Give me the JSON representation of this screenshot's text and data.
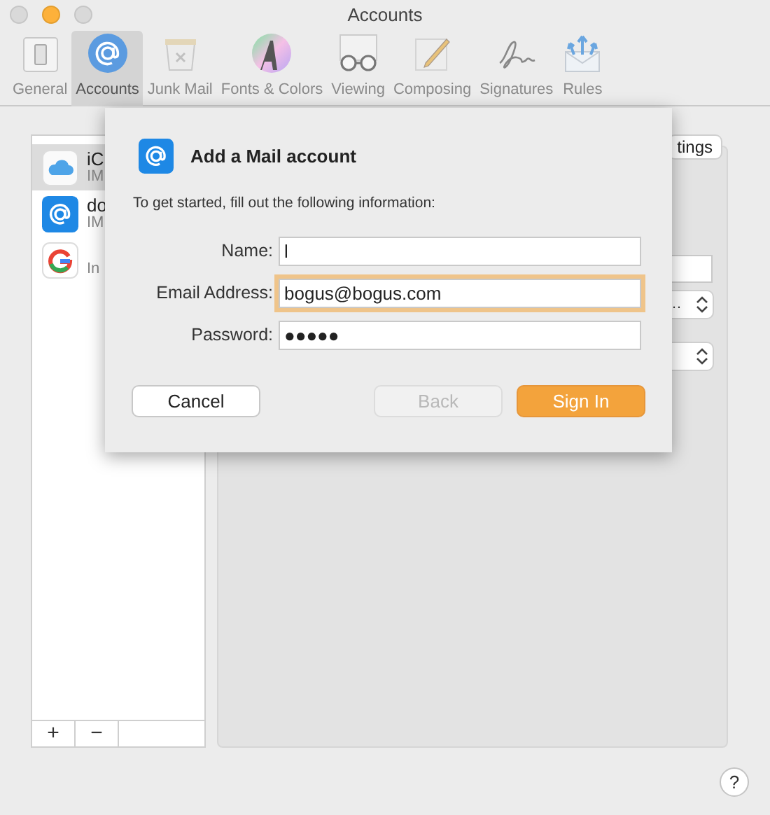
{
  "window": {
    "title": "Accounts"
  },
  "toolbar": [
    {
      "label": "General",
      "selected": false
    },
    {
      "label": "Accounts",
      "selected": true
    },
    {
      "label": "Junk Mail",
      "selected": false
    },
    {
      "label": "Fonts & Colors",
      "selected": false
    },
    {
      "label": "Viewing",
      "selected": false
    },
    {
      "label": "Composing",
      "selected": false
    },
    {
      "label": "Signatures",
      "selected": false
    },
    {
      "label": "Rules",
      "selected": false
    }
  ],
  "accounts": [
    {
      "name": "iC",
      "type": "IM",
      "selected": true
    },
    {
      "name": "do",
      "type": "IM",
      "selected": false
    },
    {
      "type": "In",
      "selected": false
    }
  ],
  "list_buttons": [
    "+",
    "−"
  ],
  "settings_button": "tings",
  "right_controls": [
    {
      "kind": "text"
    },
    {
      "kind": "select",
      "value": "…"
    },
    {
      "kind": "select"
    }
  ],
  "dialog": {
    "title": "Add a Mail account",
    "intro": "To get started, fill out the following information:",
    "fields": [
      {
        "label": "Name:",
        "value": "l",
        "focused": false
      },
      {
        "label": "Email Address:",
        "value": "bogus@bogus.com",
        "focused": true
      },
      {
        "label": "Password:",
        "value": "●●●●●",
        "focused": false
      }
    ],
    "buttons": [
      {
        "label": "Cancel",
        "kind": "normal",
        "disabled": false
      },
      {
        "label": "Back",
        "kind": "normal",
        "disabled": true
      },
      {
        "label": "Sign In",
        "kind": "default",
        "disabled": false
      }
    ]
  },
  "help": "?"
}
